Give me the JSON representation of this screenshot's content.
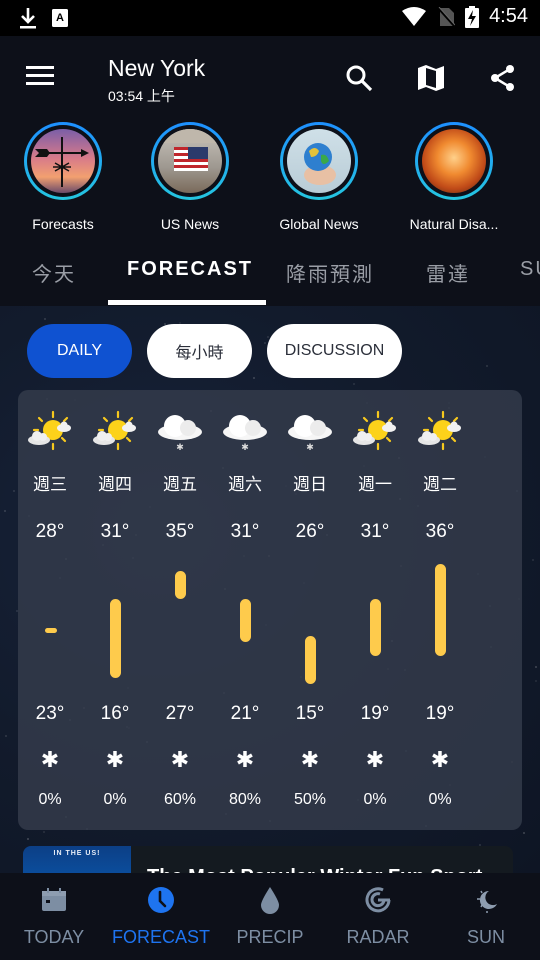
{
  "status_bar": {
    "time": "4:54",
    "left_icons": [
      "download-icon",
      "font-app-icon"
    ],
    "right_icons": [
      "wifi-icon",
      "no-sim-icon",
      "battery-charging-icon"
    ]
  },
  "header": {
    "city": "New York",
    "local_time": "03:54 上午",
    "actions": [
      "search-icon",
      "map-icon",
      "share-icon"
    ]
  },
  "stories": [
    {
      "label": "Forecasts"
    },
    {
      "label": "US News"
    },
    {
      "label": "Global News"
    },
    {
      "label": "Natural Disa..."
    }
  ],
  "tabs": [
    {
      "label": "今天",
      "active": false
    },
    {
      "label": "FORECAST",
      "active": true
    },
    {
      "label": "降雨預測",
      "active": false
    },
    {
      "label": "雷達",
      "active": false
    },
    {
      "label": "SU",
      "active": false
    }
  ],
  "view_pills": [
    {
      "label": "DAILY",
      "active": true
    },
    {
      "label": "每小時",
      "active": false
    },
    {
      "label": "DISCUSSION",
      "active": false
    }
  ],
  "colors": {
    "accent": "#1e74f0",
    "active_pill": "#0f52d1",
    "temp_bar": "#fecb4c",
    "nav_inactive": "#7d8ea3"
  },
  "forecast": {
    "days": [
      {
        "day": "週三",
        "icon": "partly-sunny",
        "high": "28°",
        "low": "23°",
        "precip_icon": "snowflake-icon",
        "precip": "0%",
        "bar_top": 0.53,
        "bar_bottom": 0.55
      },
      {
        "day": "週四",
        "icon": "partly-sunny",
        "high": "31°",
        "low": "16°",
        "precip_icon": "snowflake-icon",
        "precip": "0%",
        "bar_top": 0.29,
        "bar_bottom": 0.95
      },
      {
        "day": "週五",
        "icon": "cloud-snow",
        "high": "35°",
        "low": "27°",
        "precip_icon": "snowflake-icon",
        "precip": "60%",
        "bar_top": 0.06,
        "bar_bottom": 0.29
      },
      {
        "day": "週六",
        "icon": "cloud-snow",
        "high": "31°",
        "low": "21°",
        "precip_icon": "snowflake-icon",
        "precip": "80%",
        "bar_top": 0.29,
        "bar_bottom": 0.65
      },
      {
        "day": "週日",
        "icon": "cloud-snow",
        "high": "26°",
        "low": "15°",
        "precip_icon": "snowflake-icon",
        "precip": "50%",
        "bar_top": 0.6,
        "bar_bottom": 1.0
      },
      {
        "day": "週一",
        "icon": "partly-sunny",
        "high": "31°",
        "low": "19°",
        "precip_icon": "snowflake-icon",
        "precip": "0%",
        "bar_top": 0.29,
        "bar_bottom": 0.77
      },
      {
        "day": "週二",
        "icon": "partly-sunny",
        "high": "36°",
        "low": "19°",
        "precip_icon": "snowflake-icon",
        "precip": "0%",
        "bar_top": 0.0,
        "bar_bottom": 0.77
      }
    ]
  },
  "article": {
    "thumb_caption": "IN THE US!",
    "title": "The Most Popular Winter Fun Sport"
  },
  "bottom_nav": [
    {
      "label": "TODAY",
      "icon": "calendar-icon",
      "active": false
    },
    {
      "label": "FORECAST",
      "icon": "clock-icon",
      "active": true
    },
    {
      "label": "PRECIP",
      "icon": "drop-icon",
      "active": false
    },
    {
      "label": "RADAR",
      "icon": "radar-icon",
      "active": false
    },
    {
      "label": "SUN",
      "icon": "moon-sun-icon",
      "active": false
    }
  ]
}
